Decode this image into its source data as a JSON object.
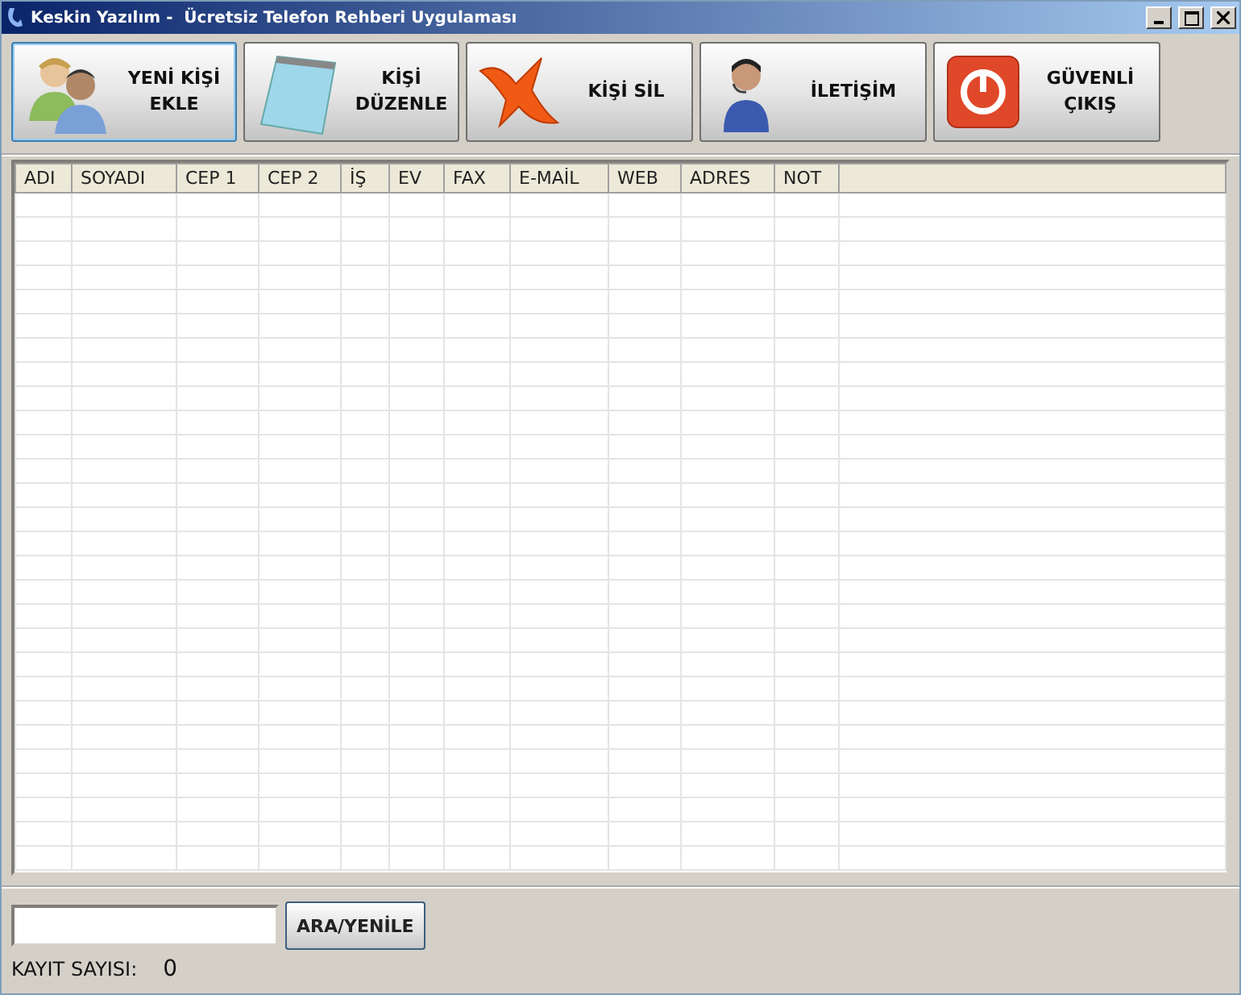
{
  "window": {
    "title": "Keskin Yazılım -  Ücretsiz Telefon Rehberi Uygulaması"
  },
  "toolbar": [
    {
      "kind": "people",
      "lines": [
        "YENİ KİŞİ",
        "EKLE"
      ],
      "focused": true
    },
    {
      "kind": "notepad",
      "lines": [
        "KİŞİ",
        "DÜZENLE"
      ],
      "focused": false
    },
    {
      "kind": "cross",
      "lines": [
        "KİŞİ SİL"
      ],
      "focused": false
    },
    {
      "kind": "headset",
      "lines": [
        "İLETİŞİM"
      ],
      "focused": false
    },
    {
      "kind": "power",
      "lines": [
        "GÜVENLİ",
        "ÇIKIŞ"
      ],
      "focused": false
    }
  ],
  "table": {
    "columns": [
      "ADI",
      "SOYADI",
      "CEP 1",
      "CEP 2",
      "İŞ",
      "EV",
      "FAX",
      "E-MAİL",
      "WEB",
      "ADRES",
      "NOT"
    ]
  },
  "search": {
    "button": "ARA/YENİLE"
  },
  "status": {
    "label": "KAYIT SAYISI:",
    "count": "0"
  }
}
